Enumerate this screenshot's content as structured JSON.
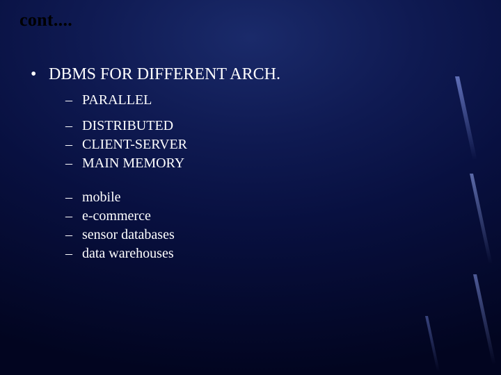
{
  "title": "cont....",
  "main_bullet": "DBMS FOR DIFFERENT ARCH.",
  "group1": {
    "item0": "PARALLEL"
  },
  "group2": {
    "item0": "DISTRIBUTED",
    "item1": "CLIENT-SERVER",
    "item2": "MAIN MEMORY"
  },
  "group3": {
    "item0": "mobile",
    "item1": "e-commerce",
    "item2": "sensor databases",
    "item3": "data warehouses"
  }
}
